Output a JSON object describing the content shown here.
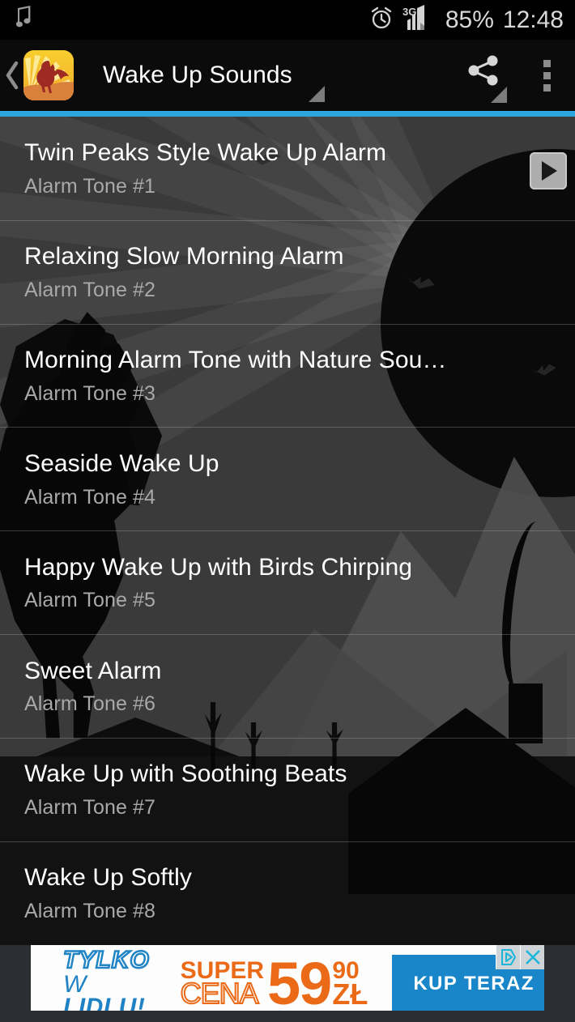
{
  "status_bar": {
    "music_icon": "music-note-icon",
    "alarm_icon": "alarm-clock-icon",
    "network_label": "3G",
    "signal_icon": "signal-bars-icon",
    "battery": "85%",
    "time": "12:48"
  },
  "action_bar": {
    "back_icon": "back-chevron-icon",
    "app_icon": "rooster-sunrise-app-icon",
    "title": "Wake Up Sounds",
    "share_icon": "share-icon",
    "overflow_icon": "overflow-menu-icon",
    "accent_color": "#2ea7e0"
  },
  "list": {
    "play_icon": "play-icon",
    "rows": [
      {
        "title": "Twin Peaks Style Wake Up Alarm",
        "subtitle": "Alarm Tone #1",
        "has_play": true
      },
      {
        "title": "Relaxing Slow Morning Alarm",
        "subtitle": "Alarm Tone #2",
        "has_play": false
      },
      {
        "title": "Morning Alarm Tone with Nature Sou…",
        "subtitle": "Alarm Tone #3",
        "has_play": false
      },
      {
        "title": "Seaside Wake Up",
        "subtitle": "Alarm Tone #4",
        "has_play": false
      },
      {
        "title": "Happy Wake Up with Birds Chirping",
        "subtitle": "Alarm Tone #5",
        "has_play": false
      },
      {
        "title": "Sweet Alarm",
        "subtitle": "Alarm Tone #6",
        "has_play": false
      },
      {
        "title": "Wake Up with Soothing Beats",
        "subtitle": "Alarm Tone #7",
        "has_play": false
      },
      {
        "title": "Wake Up Softly",
        "subtitle": "Alarm Tone #8",
        "has_play": false
      }
    ]
  },
  "ad": {
    "line1": "TYLKO",
    "line2_thin": "W ",
    "line2_bold": "LIDLU!",
    "super": "SUPER",
    "cena": "CENA",
    "price_big": "59",
    "price_cents": "90",
    "currency": "ZŁ",
    "cta": "KUP TERAZ",
    "adchoices_icon": "adchoices-icon",
    "close_icon": "close-icon",
    "blue": "#1886c8",
    "orange": "#ea6a18"
  }
}
